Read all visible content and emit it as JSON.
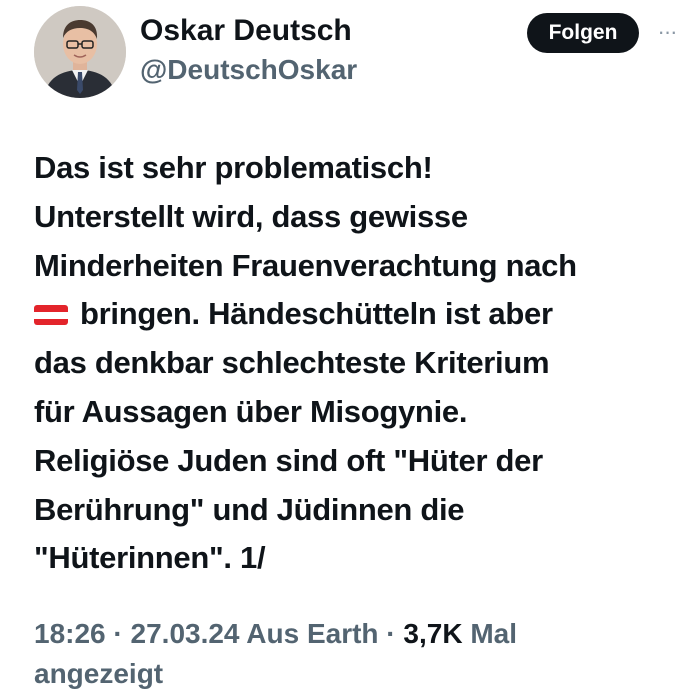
{
  "author": {
    "display_name": "Oskar Deutsch",
    "handle": "@DeutschOskar"
  },
  "follow_button": {
    "label": "Folgen"
  },
  "more_icon": "more-horizontal-icon",
  "tweet": {
    "lines": [
      "Das ist sehr problematisch!",
      "Unterstellt wird, dass gewisse",
      "Minderheiten Frauenverachtung nach",
      "bringen. Händeschütteln ist aber",
      "das denkbar schlechteste Kriterium",
      "für Aussagen über Misogynie.",
      "Religiöse Juden sind oft  \"Hüter der",
      "Berührung\" und Jüdinnen die",
      "\"Hüterinnen\". 1/"
    ],
    "flag_icon": "austria-flag-icon"
  },
  "meta": {
    "time": "18:26",
    "date": "27.03.24",
    "location": "Aus Earth",
    "separator": " · ",
    "views_count": "3,7K",
    "views_label_1": "Mal",
    "views_label_2": "angezeigt"
  },
  "colors": {
    "text_primary": "#0f1419",
    "text_secondary": "#536471",
    "button_bg": "#0f1419",
    "flag_red": "#e3242b"
  }
}
